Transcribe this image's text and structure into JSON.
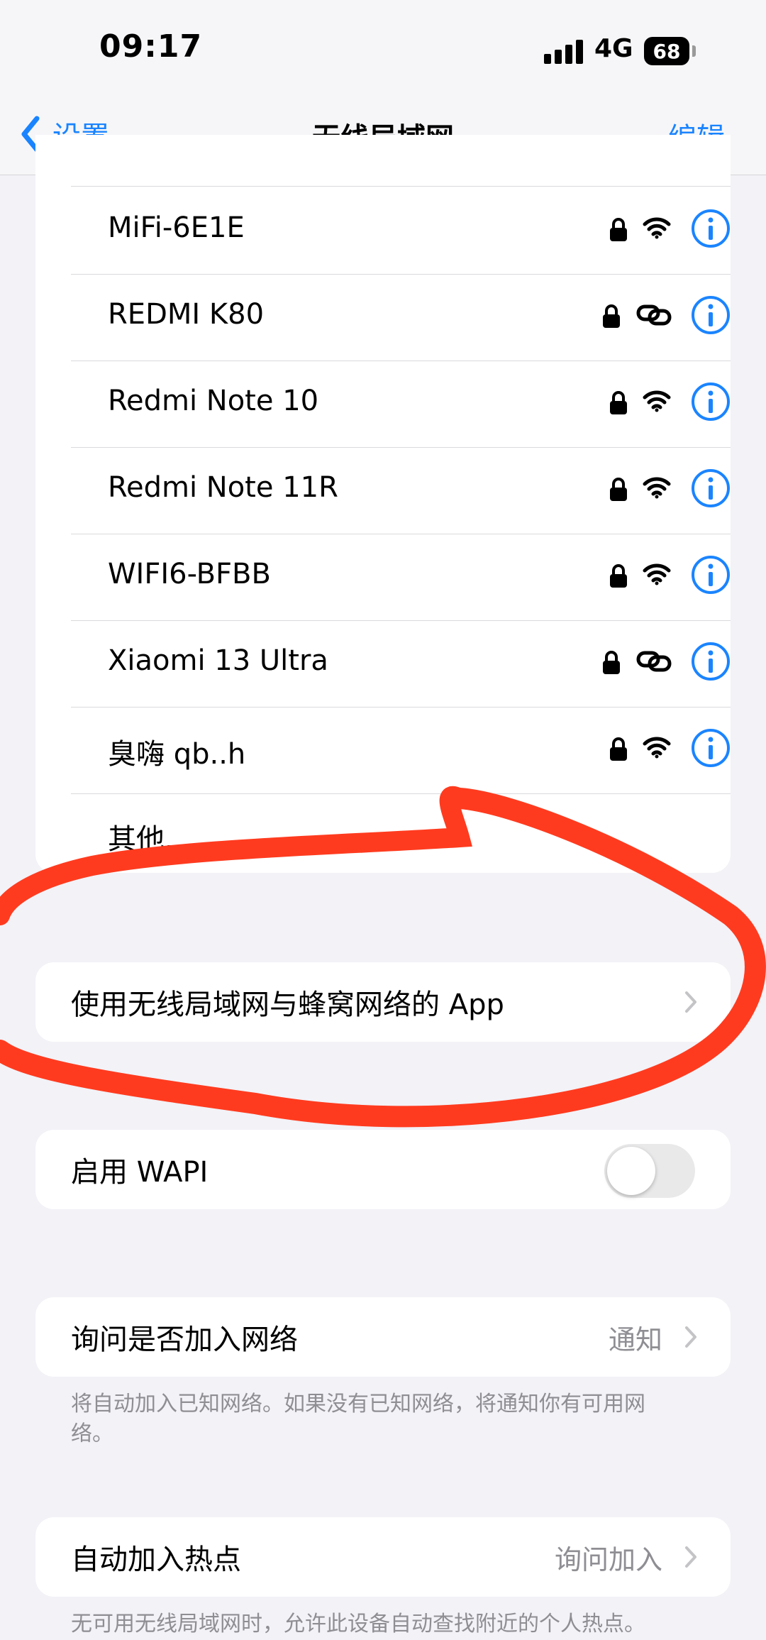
{
  "status_bar": {
    "time": "09:17",
    "network": "4G",
    "battery": "68"
  },
  "nav": {
    "back_label": "设置",
    "title": "无线局域网",
    "edit_label": "编辑"
  },
  "networks": [
    {
      "name": "MiFi-6E1E",
      "icon": "wifi-icon",
      "locked": true
    },
    {
      "name": "REDMI K80",
      "icon": "personal-hotspot-link-icon",
      "locked": true
    },
    {
      "name": "Redmi Note 10",
      "icon": "wifi-icon",
      "locked": true
    },
    {
      "name": "Redmi Note 11R",
      "icon": "wifi-icon",
      "locked": true
    },
    {
      "name": "WIFI6-BFBB",
      "icon": "wifi-icon",
      "locked": true
    },
    {
      "name": "Xiaomi 13 Ultra",
      "icon": "personal-hotspot-link-icon",
      "locked": true
    },
    {
      "name": "臭嗨 qb..h",
      "icon": "wifi-icon",
      "locked": true
    }
  ],
  "other_label": "其他...",
  "apps_row": {
    "label": "使用无线局域网与蜂窝网络的 App"
  },
  "wapi_row": {
    "label": "启用 WAPI",
    "enabled": false
  },
  "ask_join": {
    "label": "询问是否加入网络",
    "value": "通知",
    "footnote": "将自动加入已知网络。如果没有已知网络，将通知你有可用网络。"
  },
  "auto_hotspot": {
    "label": "自动加入热点",
    "value": "询问加入",
    "footnote": "无可用无线局域网时，允许此设备自动查找附近的个人热点。"
  },
  "colors": {
    "accent": "#1a84ff",
    "annotation": "#ff3b1f",
    "background": "#f2f2f7"
  }
}
